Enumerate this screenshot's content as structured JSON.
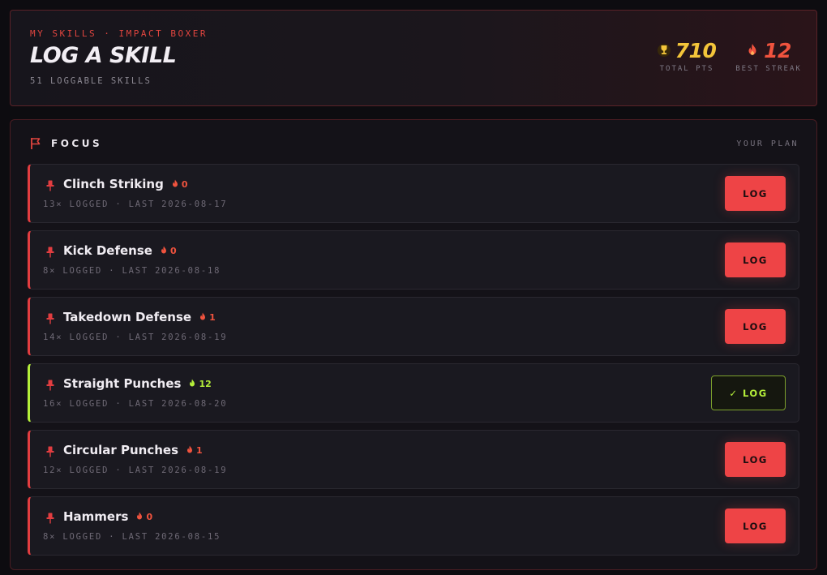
{
  "header": {
    "eyebrow": "MY SKILLS · IMPACT BOXER",
    "title": "LOG A SKILL",
    "subtitle": "51 LOGGABLE SKILLS",
    "stats": [
      {
        "value": "710",
        "label": "TOTAL PTS",
        "icon": "trophy-icon",
        "color": "#f3c53a"
      },
      {
        "value": "12",
        "label": "BEST STREAK",
        "icon": "flame-icon",
        "color": "#f0533e"
      }
    ]
  },
  "focus": {
    "label": "FOCUS",
    "plan_label": "YOUR PLAN",
    "items": [
      {
        "name": "Clinch Striking",
        "streak": "0",
        "meta": "13× LOGGED · LAST 2026-08-17",
        "button": "LOG",
        "done": false
      },
      {
        "name": "Kick Defense",
        "streak": "0",
        "meta": "8× LOGGED · LAST 2026-08-18",
        "button": "LOG",
        "done": false
      },
      {
        "name": "Takedown Defense",
        "streak": "1",
        "meta": "14× LOGGED · LAST 2026-08-19",
        "button": "LOG",
        "done": false
      },
      {
        "name": "Straight Punches",
        "streak": "12",
        "meta": "16× LOGGED · LAST 2026-08-20",
        "button": "✓ LOG",
        "done": true
      },
      {
        "name": "Circular Punches",
        "streak": "1",
        "meta": "12× LOGGED · LAST 2026-08-19",
        "button": "LOG",
        "done": false
      },
      {
        "name": "Hammers",
        "streak": "0",
        "meta": "8× LOGGED · LAST 2026-08-15",
        "button": "LOG",
        "done": false
      }
    ]
  },
  "colors": {
    "accent": "#ee4446",
    "done": "#b5ef3a",
    "gold": "#f3c53a",
    "flame": "#f0533e"
  }
}
